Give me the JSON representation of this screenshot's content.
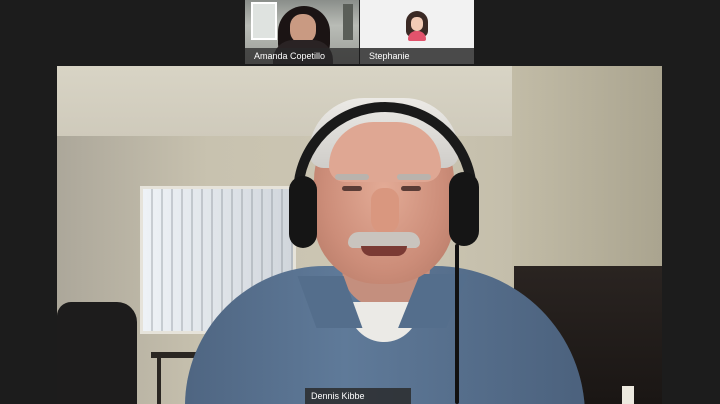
{
  "participants": [
    {
      "name": "Amanda Copetillo",
      "video": "on"
    },
    {
      "name": "Stephanie",
      "video": "off",
      "avatar": "cartoon-woman-avatar"
    }
  ],
  "active_speaker": {
    "name": "Dennis Kibbe"
  },
  "colors": {
    "background": "#1c1c1c",
    "label_bg": "#333333",
    "label_text": "#ffffff",
    "avatar_accent": "#e2536c"
  }
}
